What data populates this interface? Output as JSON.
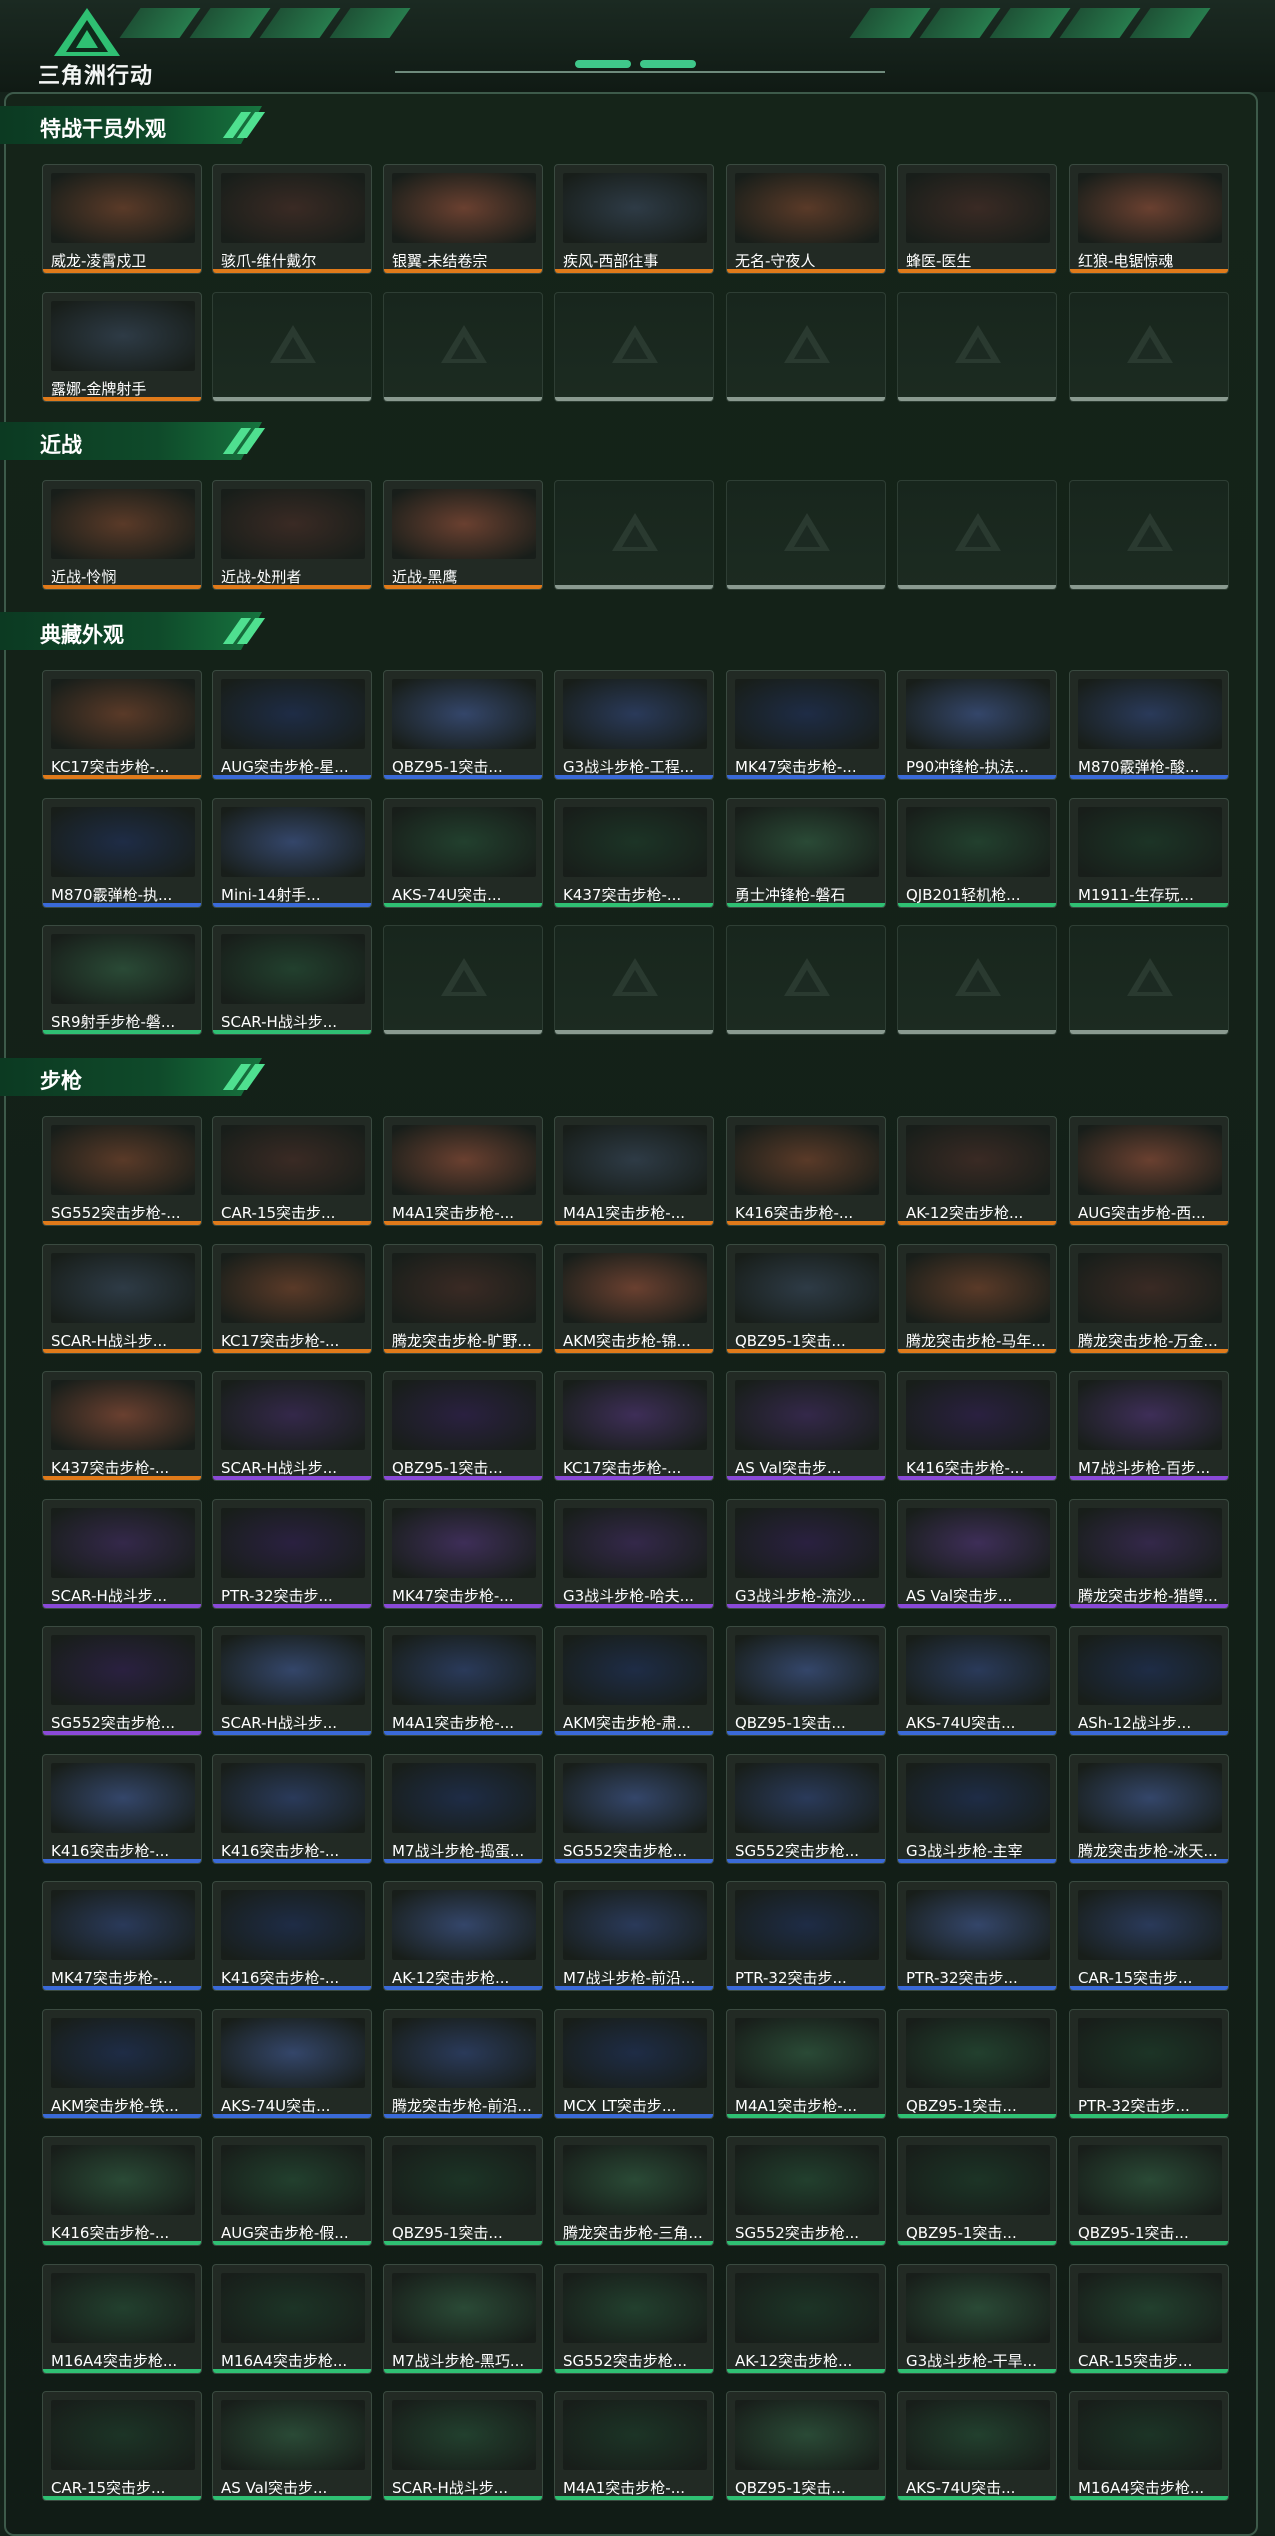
{
  "header": {
    "logo_text": "三角洲行动",
    "logo_icon": "triangle-logo-icon",
    "brand_color": "#2a8a55"
  },
  "colors": {
    "gold": "#e07a1a",
    "blue": "#3a6ad8",
    "green": "#2fc073",
    "purple": "#8a4ad8",
    "empty": "#8a9a90"
  },
  "sections": [
    {
      "title": "特战干员外观",
      "items": [
        {
          "label": "威龙-凌霄戍卫",
          "tier": "gold"
        },
        {
          "label": "骇爪-维什戴尔",
          "tier": "gold"
        },
        {
          "label": "银翼-未结卷宗",
          "tier": "gold"
        },
        {
          "label": "疾风-西部往事",
          "tier": "gold"
        },
        {
          "label": "无名-守夜人",
          "tier": "gold"
        },
        {
          "label": "蜂医-医生",
          "tier": "gold"
        },
        {
          "label": "红狼-电锯惊魂",
          "tier": "gold"
        },
        {
          "label": "露娜-金牌射手",
          "tier": "gold"
        },
        {
          "label": "",
          "tier": "empty"
        },
        {
          "label": "",
          "tier": "empty"
        },
        {
          "label": "",
          "tier": "empty"
        },
        {
          "label": "",
          "tier": "empty"
        },
        {
          "label": "",
          "tier": "empty"
        },
        {
          "label": "",
          "tier": "empty"
        }
      ]
    },
    {
      "title": "近战",
      "items": [
        {
          "label": "近战-怜悯",
          "tier": "gold"
        },
        {
          "label": "近战-处刑者",
          "tier": "gold"
        },
        {
          "label": "近战-黑鹰",
          "tier": "gold"
        },
        {
          "label": "",
          "tier": "empty"
        },
        {
          "label": "",
          "tier": "empty"
        },
        {
          "label": "",
          "tier": "empty"
        },
        {
          "label": "",
          "tier": "empty"
        }
      ]
    },
    {
      "title": "典藏外观",
      "items": [
        {
          "label": "KC17突击步枪-...",
          "tier": "gold"
        },
        {
          "label": "AUG突击步枪-星...",
          "tier": "blue"
        },
        {
          "label": "QBZ95-1突击...",
          "tier": "blue"
        },
        {
          "label": "G3战斗步枪-工程...",
          "tier": "blue"
        },
        {
          "label": "MK47突击步枪-...",
          "tier": "blue"
        },
        {
          "label": "P90冲锋枪-执法...",
          "tier": "blue"
        },
        {
          "label": "M870霰弹枪-酸...",
          "tier": "blue"
        },
        {
          "label": "M870霰弹枪-执...",
          "tier": "blue"
        },
        {
          "label": "Mini-14射手...",
          "tier": "blue"
        },
        {
          "label": "AKS-74U突击...",
          "tier": "green"
        },
        {
          "label": "K437突击步枪-...",
          "tier": "green"
        },
        {
          "label": "勇士冲锋枪-磐石",
          "tier": "green"
        },
        {
          "label": "QJB201轻机枪...",
          "tier": "green"
        },
        {
          "label": "M1911-生存玩...",
          "tier": "green"
        },
        {
          "label": "SR9射手步枪-磐...",
          "tier": "green"
        },
        {
          "label": "SCAR-H战斗步...",
          "tier": "green"
        },
        {
          "label": "",
          "tier": "empty"
        },
        {
          "label": "",
          "tier": "empty"
        },
        {
          "label": "",
          "tier": "empty"
        },
        {
          "label": "",
          "tier": "empty"
        },
        {
          "label": "",
          "tier": "empty"
        }
      ]
    },
    {
      "title": "步枪",
      "items": [
        {
          "label": "SG552突击步枪-...",
          "tier": "gold"
        },
        {
          "label": "CAR-15突击步...",
          "tier": "gold"
        },
        {
          "label": "M4A1突击步枪-...",
          "tier": "gold"
        },
        {
          "label": "M4A1突击步枪-...",
          "tier": "gold"
        },
        {
          "label": "K416突击步枪-...",
          "tier": "gold"
        },
        {
          "label": "AK-12突击步枪...",
          "tier": "gold"
        },
        {
          "label": "AUG突击步枪-西...",
          "tier": "gold"
        },
        {
          "label": "SCAR-H战斗步...",
          "tier": "gold"
        },
        {
          "label": "KC17突击步枪-...",
          "tier": "gold"
        },
        {
          "label": "腾龙突击步枪-旷野...",
          "tier": "gold"
        },
        {
          "label": "AKM突击步枪-锦...",
          "tier": "gold"
        },
        {
          "label": "QBZ95-1突击...",
          "tier": "gold"
        },
        {
          "label": "腾龙突击步枪-马年...",
          "tier": "gold"
        },
        {
          "label": "腾龙突击步枪-万金...",
          "tier": "gold"
        },
        {
          "label": "K437突击步枪-...",
          "tier": "gold"
        },
        {
          "label": "SCAR-H战斗步...",
          "tier": "purple"
        },
        {
          "label": "QBZ95-1突击...",
          "tier": "purple"
        },
        {
          "label": "KC17突击步枪-...",
          "tier": "purple"
        },
        {
          "label": "AS Val突击步...",
          "tier": "purple"
        },
        {
          "label": "K416突击步枪-...",
          "tier": "purple"
        },
        {
          "label": "M7战斗步枪-百步...",
          "tier": "purple"
        },
        {
          "label": "SCAR-H战斗步...",
          "tier": "purple"
        },
        {
          "label": "PTR-32突击步...",
          "tier": "purple"
        },
        {
          "label": "MK47突击步枪-...",
          "tier": "purple"
        },
        {
          "label": "G3战斗步枪-哈夫...",
          "tier": "purple"
        },
        {
          "label": "G3战斗步枪-流沙...",
          "tier": "purple"
        },
        {
          "label": "AS Val突击步...",
          "tier": "purple"
        },
        {
          "label": "腾龙突击步枪-猎鳄...",
          "tier": "purple"
        },
        {
          "label": "SG552突击步枪...",
          "tier": "purple"
        },
        {
          "label": "SCAR-H战斗步...",
          "tier": "blue"
        },
        {
          "label": "M4A1突击步枪-...",
          "tier": "blue"
        },
        {
          "label": "AKM突击步枪-肃...",
          "tier": "blue"
        },
        {
          "label": "QBZ95-1突击...",
          "tier": "blue"
        },
        {
          "label": "AKS-74U突击...",
          "tier": "blue"
        },
        {
          "label": "ASh-12战斗步...",
          "tier": "blue"
        },
        {
          "label": "K416突击步枪-...",
          "tier": "blue"
        },
        {
          "label": "K416突击步枪-...",
          "tier": "blue"
        },
        {
          "label": "M7战斗步枪-捣蛋...",
          "tier": "blue"
        },
        {
          "label": "SG552突击步枪...",
          "tier": "blue"
        },
        {
          "label": "SG552突击步枪...",
          "tier": "blue"
        },
        {
          "label": "G3战斗步枪-主宰",
          "tier": "blue"
        },
        {
          "label": "腾龙突击步枪-冰天...",
          "tier": "blue"
        },
        {
          "label": "MK47突击步枪-...",
          "tier": "blue"
        },
        {
          "label": "K416突击步枪-...",
          "tier": "blue"
        },
        {
          "label": "AK-12突击步枪...",
          "tier": "blue"
        },
        {
          "label": "M7战斗步枪-前沿...",
          "tier": "blue"
        },
        {
          "label": "PTR-32突击步...",
          "tier": "blue"
        },
        {
          "label": "PTR-32突击步...",
          "tier": "blue"
        },
        {
          "label": "CAR-15突击步...",
          "tier": "blue"
        },
        {
          "label": "AKM突击步枪-铁...",
          "tier": "blue"
        },
        {
          "label": "AKS-74U突击...",
          "tier": "blue"
        },
        {
          "label": "腾龙突击步枪-前沿...",
          "tier": "blue"
        },
        {
          "label": "MCX LT突击步...",
          "tier": "blue"
        },
        {
          "label": "M4A1突击步枪-...",
          "tier": "green"
        },
        {
          "label": "QBZ95-1突击...",
          "tier": "green"
        },
        {
          "label": "PTR-32突击步...",
          "tier": "green"
        },
        {
          "label": "K416突击步枪-...",
          "tier": "green"
        },
        {
          "label": "AUG突击步枪-假...",
          "tier": "green"
        },
        {
          "label": "QBZ95-1突击...",
          "tier": "green"
        },
        {
          "label": "腾龙突击步枪-三角...",
          "tier": "green"
        },
        {
          "label": "SG552突击步枪...",
          "tier": "green"
        },
        {
          "label": "QBZ95-1突击...",
          "tier": "green"
        },
        {
          "label": "QBZ95-1突击...",
          "tier": "green"
        },
        {
          "label": "M16A4突击步枪...",
          "tier": "green"
        },
        {
          "label": "M16A4突击步枪...",
          "tier": "green"
        },
        {
          "label": "M7战斗步枪-黑巧...",
          "tier": "green"
        },
        {
          "label": "SG552突击步枪...",
          "tier": "green"
        },
        {
          "label": "AK-12突击步枪...",
          "tier": "green"
        },
        {
          "label": "G3战斗步枪-干旱...",
          "tier": "green"
        },
        {
          "label": "CAR-15突击步...",
          "tier": "green"
        },
        {
          "label": "CAR-15突击步...",
          "tier": "green"
        },
        {
          "label": "AS Val突击步...",
          "tier": "green"
        },
        {
          "label": "SCAR-H战斗步...",
          "tier": "green"
        },
        {
          "label": "M4A1突击步枪-...",
          "tier": "green"
        },
        {
          "label": "QBZ95-1突击...",
          "tier": "green"
        },
        {
          "label": "AKS-74U突击...",
          "tier": "green"
        },
        {
          "label": "M16A4突击步枪...",
          "tier": "green"
        }
      ]
    }
  ]
}
